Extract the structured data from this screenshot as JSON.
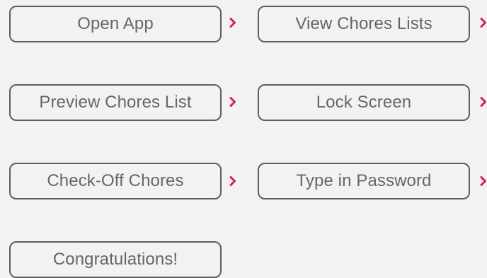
{
  "accent_color": "#d81b60",
  "steps": [
    {
      "label": "Open App"
    },
    {
      "label": "View Chores Lists"
    },
    {
      "label": "Preview Chores List"
    },
    {
      "label": "Lock Screen"
    },
    {
      "label": "Check-Off Chores"
    },
    {
      "label": "Type in Password"
    },
    {
      "label": "Congratulations!"
    }
  ],
  "connectors": [
    {
      "icon": "chevron-right-icon"
    },
    {
      "icon": "chevron-right-icon"
    },
    {
      "icon": "chevron-right-icon"
    },
    {
      "icon": "chevron-right-icon"
    },
    {
      "icon": "chevron-right-icon"
    },
    {
      "icon": "chevron-right-icon"
    }
  ]
}
